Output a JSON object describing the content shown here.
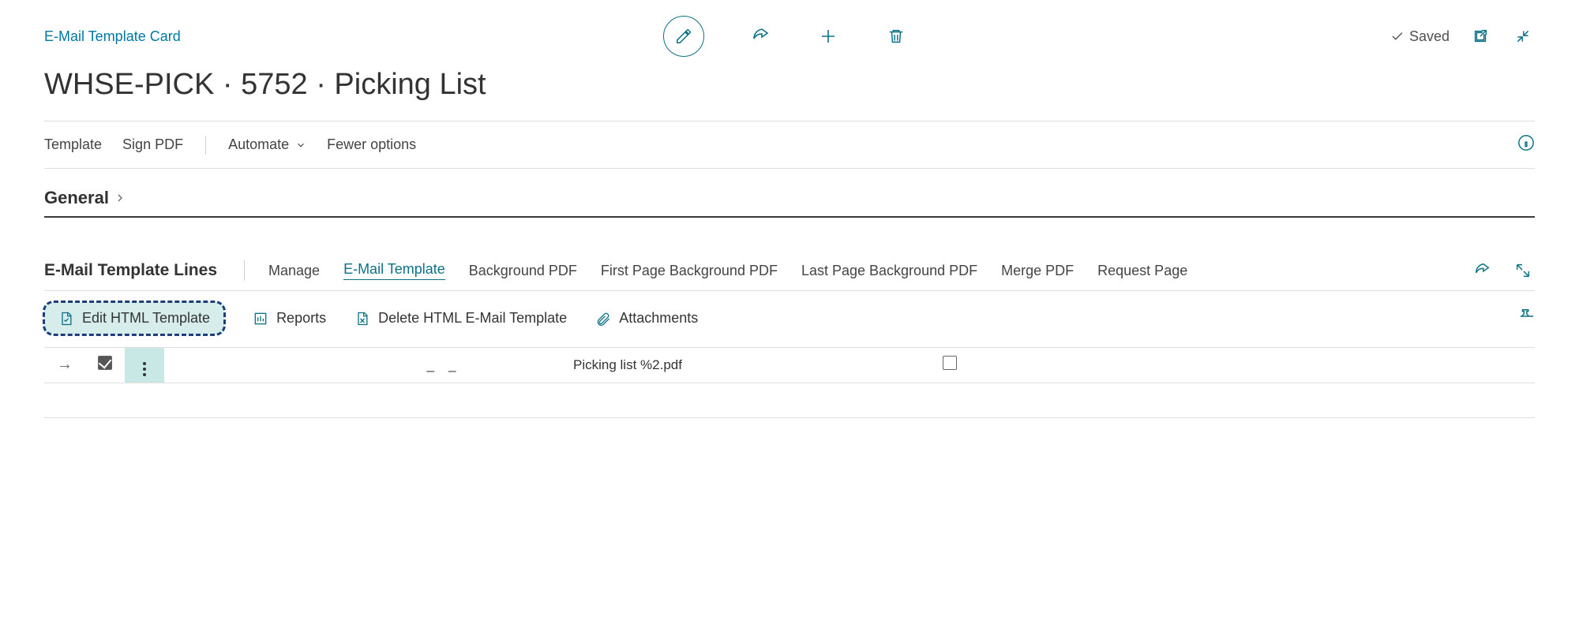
{
  "header": {
    "breadcrumb": "E-Mail Template Card",
    "saved_label": "Saved",
    "page_title": "WHSE-PICK · 5752 · Picking List"
  },
  "menubar": {
    "template": "Template",
    "sign_pdf": "Sign PDF",
    "automate": "Automate",
    "fewer_options": "Fewer options"
  },
  "fasttab": {
    "general": "General"
  },
  "lines": {
    "title": "E-Mail Template Lines",
    "tabs": {
      "manage": "Manage",
      "email_template": "E-Mail Template",
      "background_pdf": "Background PDF",
      "first_page_bg": "First Page Background PDF",
      "last_page_bg": "Last Page Background PDF",
      "merge_pdf": "Merge PDF",
      "request_page": "Request Page"
    },
    "actions": {
      "edit_html": "Edit HTML Template",
      "reports": "Reports",
      "delete_html": "Delete HTML E-Mail Template",
      "attachments": "Attachments"
    },
    "row": {
      "dash1": "_",
      "dash2": "_",
      "filename": "Picking list %2.pdf"
    }
  }
}
